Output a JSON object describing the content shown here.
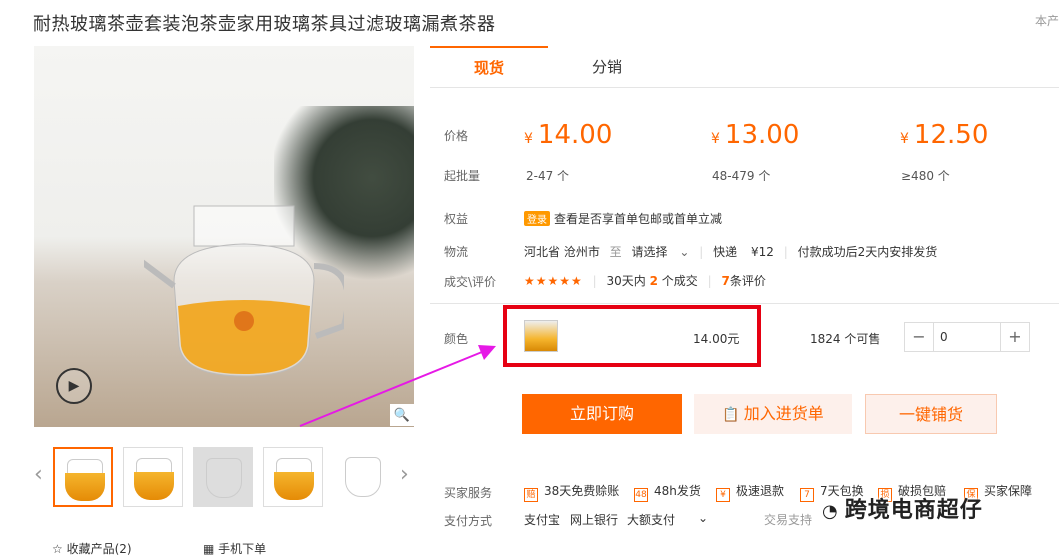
{
  "title": "耐热玻璃茶壶套装泡茶壶家用玻璃茶具过滤玻璃漏煮茶器",
  "top_right": "本产",
  "tabs": [
    {
      "label": "现货"
    },
    {
      "label": "分销"
    }
  ],
  "labels": {
    "price": "价格",
    "moq": "起批量",
    "rights": "权益",
    "logistics": "物流",
    "reviews": "成交\\评价",
    "color": "颜色",
    "buyer_service": "买家服务",
    "payment": "支付方式"
  },
  "prices": [
    {
      "currency": "¥",
      "value": "14.00",
      "range": "2-47 个"
    },
    {
      "currency": "¥",
      "value": "13.00",
      "range": "48-479 个"
    },
    {
      "currency": "¥",
      "value": "12.50",
      "range": "≥480 个"
    }
  ],
  "rights": {
    "badge": "登录",
    "text": "查看是否享首单包邮或首单立减"
  },
  "logistics": {
    "from": "河北省 沧州市",
    "to_word": "至",
    "to_select": "请选择",
    "method": "快递",
    "fee": "¥12",
    "ship_text": "付款成功后2天内安排发货"
  },
  "reviews": {
    "stars": "★★★★★",
    "deal_prefix": "30天内",
    "deal_count": "2",
    "deal_suffix": "个成交",
    "review_count": "7",
    "review_suffix": "条评价"
  },
  "color_option": {
    "price": "14.00元",
    "stock": "1824 个可售",
    "quantity": "0"
  },
  "stepper": {
    "minus": "−",
    "plus": "+"
  },
  "buttons": {
    "buy": "立即订购",
    "cart": "加入进货单",
    "distribute": "一键铺货"
  },
  "services": [
    {
      "icon": "赔",
      "label": "38天免费赊账"
    },
    {
      "icon": "48",
      "label": "48h发货"
    },
    {
      "icon": "¥",
      "label": "极速退款"
    },
    {
      "icon": "7",
      "label": "7天包换"
    },
    {
      "icon": "损",
      "label": "破损包赔"
    },
    {
      "icon": "保",
      "label": "买家保障"
    }
  ],
  "payment": {
    "methods": [
      "支付宝",
      "网上银行",
      "大额支付"
    ],
    "trade_support": "交易支持"
  },
  "gallery": {
    "collect": "收藏产品(2)",
    "mobile": "手机下单"
  },
  "watermark": "跨境电商超仔",
  "colors": {
    "accent": "#ff6600",
    "highlight_box": "#e60012",
    "arrow": "#e619e6"
  }
}
